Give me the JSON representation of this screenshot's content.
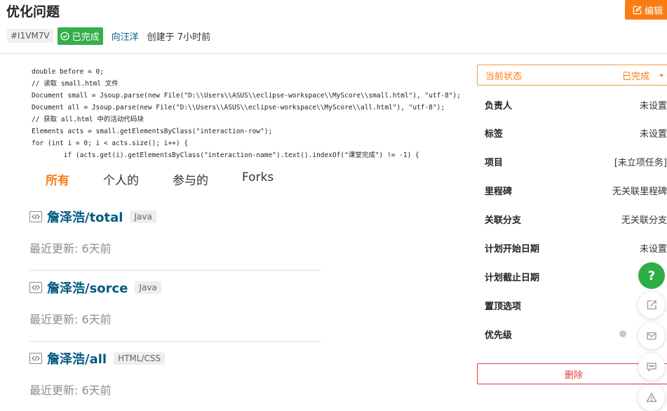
{
  "issue": {
    "title": "优化问题",
    "id": "#I1VM7V",
    "status": "已完成",
    "author": "向汪洋",
    "created": "创建于 7小时前"
  },
  "toolbar": {
    "edit_label": "编辑"
  },
  "code_lines": [
    "double before = 0;",
    "// 读取 small.html 文件",
    "Document small = Jsoup.parse(new File(\"D:\\\\Users\\\\ASUS\\\\eclipse-workspace\\\\MyScore\\\\small.html\"), \"utf-8\");",
    "Document all = Jsoup.parse(new File(\"D:\\\\Users\\\\ASUS\\\\eclipse-workspace\\\\MyScore\\\\all.html\"), \"utf-8\");",
    "// 获取 all.html 中的活动代码块",
    "Elements acts = small.getElementsByClass(\"interaction-row\");",
    "for (int i = 0; i < acts.size(); i++) {",
    "        if (acts.get(i).getElementsByClass(\"interaction-name\").text().indexOf(\"课堂完成\") != -1) {"
  ],
  "tabs": [
    "所有",
    "个人的",
    "参与的",
    "Forks"
  ],
  "repos": [
    {
      "name": "詹泽浩/total",
      "lang": "Java",
      "updated": "最近更新: 6天前"
    },
    {
      "name": "詹泽浩/sorce",
      "lang": "Java",
      "updated": "最近更新: 6天前"
    },
    {
      "name": "詹泽浩/all",
      "lang": "HTML/CSS",
      "updated": "最近更新: 6天前"
    }
  ],
  "sidebar": {
    "status_label": "当前状态",
    "status_value": "已完成",
    "fields": [
      {
        "label": "负责人",
        "value": "未设置"
      },
      {
        "label": "标签",
        "value": "未设置"
      },
      {
        "label": "项目",
        "value": "[未立项任务]"
      },
      {
        "label": "里程碑",
        "value": "无关联里程碑"
      },
      {
        "label": "关联分支",
        "value": "无关联分支"
      },
      {
        "label": "计划开始日期",
        "value": "未设置"
      },
      {
        "label": "计划截止日期",
        "value": ""
      },
      {
        "label": "置顶选项",
        "value": ""
      },
      {
        "label": "优先级",
        "value": ""
      }
    ],
    "delete_label": "删除"
  },
  "fabs": {
    "help_label": "?"
  },
  "colors": {
    "accent": "#fa7d14",
    "success": "#36ae4b",
    "link": "#005980",
    "danger": "#e24040"
  }
}
